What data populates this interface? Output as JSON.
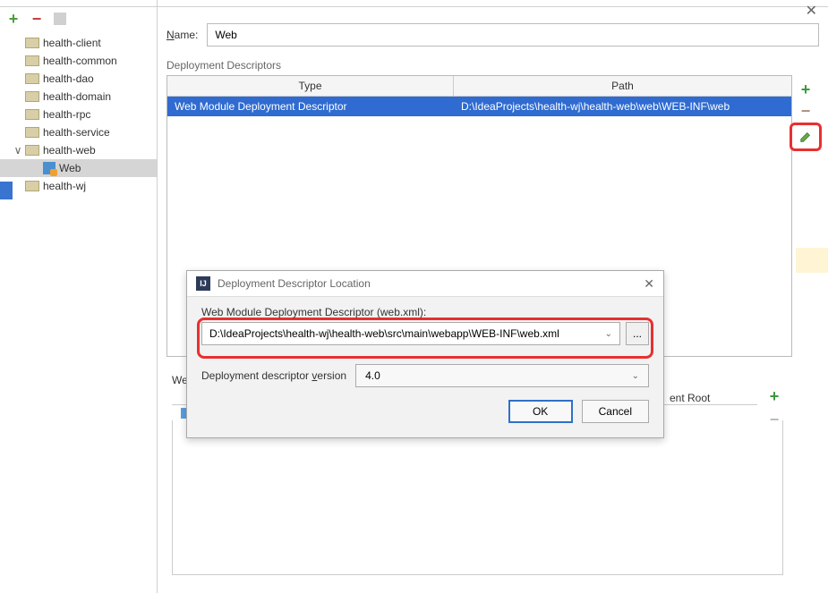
{
  "window": {
    "close_hint": "✕"
  },
  "left": {
    "toolbar": {
      "add": "+",
      "remove": "−"
    },
    "tree": [
      {
        "label": "health-client",
        "level": 1
      },
      {
        "label": "health-common",
        "level": 1
      },
      {
        "label": "health-dao",
        "level": 1
      },
      {
        "label": "health-domain",
        "level": 1
      },
      {
        "label": "health-rpc",
        "level": 1
      },
      {
        "label": "health-service",
        "level": 1
      },
      {
        "label": "health-web",
        "level": 1,
        "chevron": "∨"
      },
      {
        "label": "Web",
        "level": 2,
        "selected": true,
        "icon": "web"
      },
      {
        "label": "health-wj",
        "level": 1
      }
    ]
  },
  "right": {
    "name_label_pre": "N",
    "name_label_suf": "ame:",
    "name_value": "Web",
    "section1_label": "Deployment Descriptors",
    "table": {
      "headers": {
        "type": "Type",
        "path": "Path"
      },
      "row": {
        "type": "Web Module Deployment Descriptor",
        "path": "D:\\IdeaProjects\\health-wj\\health-web\\web\\WEB-INF\\web"
      }
    },
    "web_resources_label": "We",
    "content_root": "ent Root"
  },
  "sidebtns": {
    "add": "+",
    "remove": "−",
    "help": "?"
  },
  "dialog": {
    "title": "Deployment Descriptor Location",
    "ij": "IJ",
    "close": "✕",
    "field1_label": "Web Module Deployment Descriptor (web.xml):",
    "field1_value": "D:\\IdeaProjects\\health-wj\\health-web\\src\\main\\webapp\\WEB-INF\\web.xml",
    "dots": "...",
    "version_label_pre": "Deployment descriptor ",
    "version_label_u": "v",
    "version_label_suf": "ersion",
    "version_value": "4.0",
    "ok": "OK",
    "cancel": "Cancel"
  }
}
